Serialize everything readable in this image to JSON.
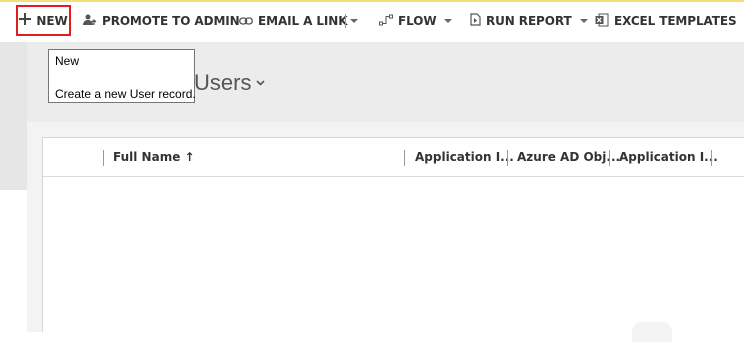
{
  "toolbar": {
    "new_label": "NEW",
    "promote_label": "PROMOTE TO ADMIN",
    "email_label": "EMAIL A LINK",
    "flow_label": "FLOW",
    "run_report_label": "RUN REPORT",
    "excel_templates_label": "EXCEL TEMPLATES",
    "highlight_color": "#e01e1e"
  },
  "tooltip": {
    "title": "New",
    "description": "Create a new User record."
  },
  "view": {
    "title": "Users"
  },
  "grid": {
    "columns": [
      "Full Name ↑",
      "Application I...",
      "Azure AD Obj...",
      "Application I..."
    ]
  }
}
